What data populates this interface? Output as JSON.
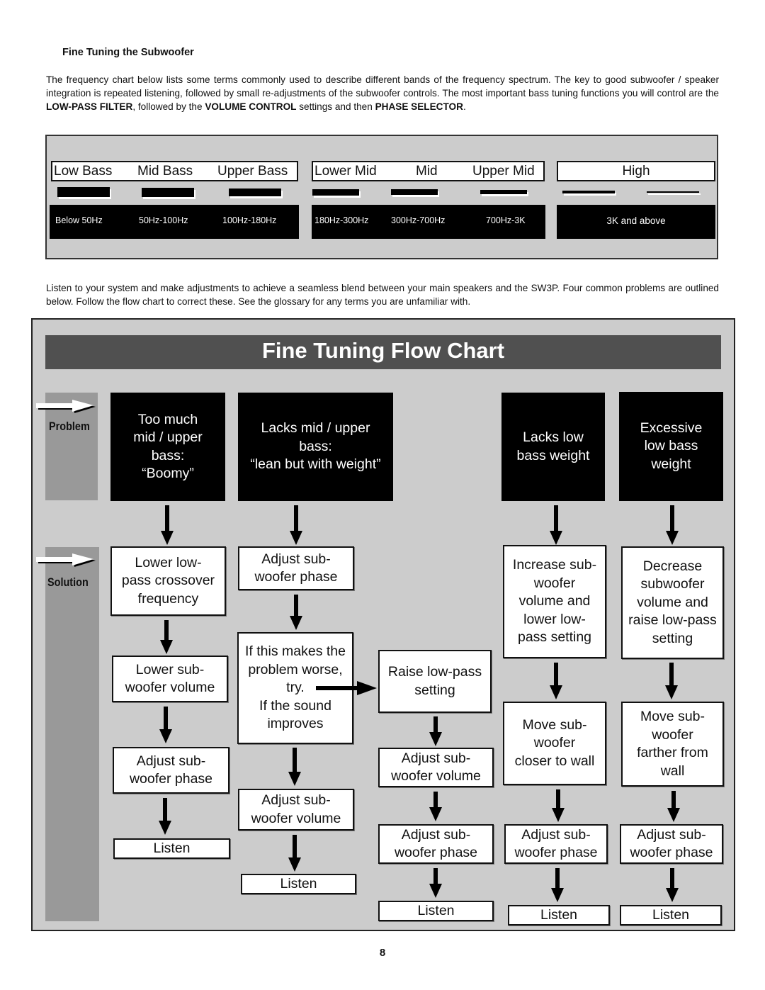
{
  "section_heading": "Fine Tuning the Subwoofer",
  "intro": {
    "part1": "The frequency chart below lists some terms commonly used to describe different bands of the frequency spectrum.  The key to good subwoofer / speaker integration is repeated listening, followed by small re-adjustments of the subwoofer controls.  The most important bass tuning functions you will control are the ",
    "bold1": "LOW-PASS FILTER",
    "part2": ", followed by the ",
    "bold2": "VOLUME CONTROL",
    "part3": " settings and then ",
    "bold3": "PHASE SELECTOR",
    "part4": "."
  },
  "frequency_chart": {
    "groups": [
      {
        "bands": [
          {
            "name": "Low Bass",
            "range": "Below 50Hz"
          },
          {
            "name": "Mid Bass",
            "range": "50Hz-100Hz"
          },
          {
            "name": "Upper Bass",
            "range": "100Hz-180Hz"
          }
        ]
      },
      {
        "bands": [
          {
            "name": "Lower Mid",
            "range": "180Hz-300Hz"
          },
          {
            "name": "Mid",
            "range": "300Hz-700Hz"
          },
          {
            "name": "Upper Mid",
            "range": "700Hz-3K"
          }
        ]
      },
      {
        "bands": [
          {
            "name": "High",
            "range": "3K and above"
          }
        ]
      }
    ]
  },
  "listen_paragraph": "Listen to your system and make adjustments to achieve a seamless blend between your main speakers and the SW3P.  Four common problems are outlined below.  Follow the flow chart to correct these.  See the glossary for any terms you are unfamiliar with.",
  "flow_chart": {
    "title": "Fine Tuning Flow Chart",
    "row_labels": {
      "problem": "Problem",
      "solution": "Solution"
    },
    "columns": [
      {
        "problem": "Too much\nmid / upper\nbass:\n“Boomy”",
        "steps": [
          "Lower low-\npass crossover\nfrequency",
          "Lower sub-\nwoofer volume",
          "Adjust sub-\nwoofer phase",
          "Listen"
        ]
      },
      {
        "problem": "Lacks mid / upper\nbass:\n“lean but with weight”",
        "steps": [
          "Adjust sub-\nwoofer phase",
          "If this makes the\nproblem worse,\ntry.\nIf the sound\nimproves",
          "Adjust sub-\nwoofer volume",
          "Listen"
        ],
        "branch_steps": [
          "Raise low-pass\nsetting",
          "Adjust sub-\nwoofer volume",
          "Adjust sub-\nwoofer phase",
          "Listen"
        ]
      },
      {
        "problem": "Lacks low\nbass weight",
        "steps": [
          "Increase sub-\nwoofer\nvolume and\nlower low-\npass setting",
          "Move sub-\nwoofer\ncloser to wall",
          "Adjust sub-\nwoofer phase",
          "Listen"
        ]
      },
      {
        "problem": "Excessive\nlow bass\nweight",
        "steps": [
          "Decrease\nsubwoofer\nvolume and\nraise low-pass\nsetting",
          "Move sub-\nwoofer\nfarther from\nwall",
          "Adjust sub-\nwoofer phase",
          "Listen"
        ]
      }
    ]
  },
  "page_number": "8"
}
